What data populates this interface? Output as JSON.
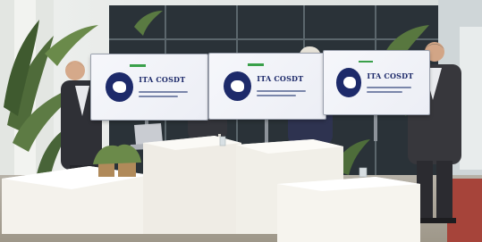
{
  "photo": {
    "screens": [
      {
        "brand": "ITA COSDT"
      },
      {
        "brand": "ITA COSDT"
      },
      {
        "brand": "ITA COSDT"
      }
    ],
    "colors": {
      "wall": "#e9ecea",
      "window": "#2a3238",
      "podium": "#f4f2ec",
      "suit": "#2f3036",
      "logo_navy": "#1d2a6a",
      "logo_green": "#3aa04a"
    }
  }
}
